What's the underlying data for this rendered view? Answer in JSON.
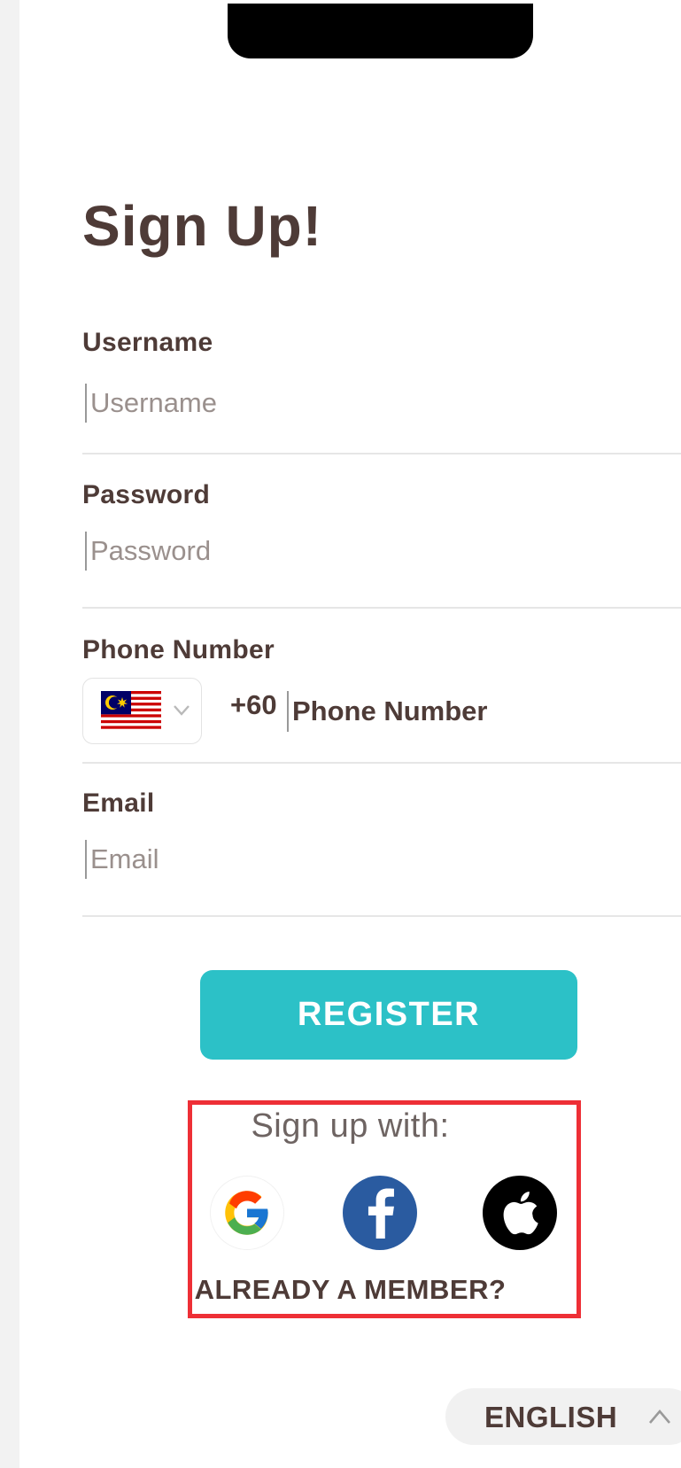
{
  "title": "Sign Up!",
  "form": {
    "username": {
      "label": "Username",
      "placeholder": "Username"
    },
    "password": {
      "label": "Password",
      "placeholder": "Password"
    },
    "phone": {
      "label": "Phone Number",
      "country": "Malaysia",
      "prefix": "+60",
      "placeholder": "Phone Number"
    },
    "email": {
      "label": "Email",
      "placeholder": "Email"
    }
  },
  "register_label": "REGISTER",
  "social": {
    "heading": "Sign up with:",
    "providers": [
      "google-icon",
      "facebook-icon",
      "apple-icon"
    ]
  },
  "already_member": "ALREADY A MEMBER?",
  "language": "ENGLISH",
  "colors": {
    "accent": "#2cc1c7",
    "text": "#4e3b37",
    "facebook": "#2a5ba0",
    "highlight": "#ee2f36"
  }
}
